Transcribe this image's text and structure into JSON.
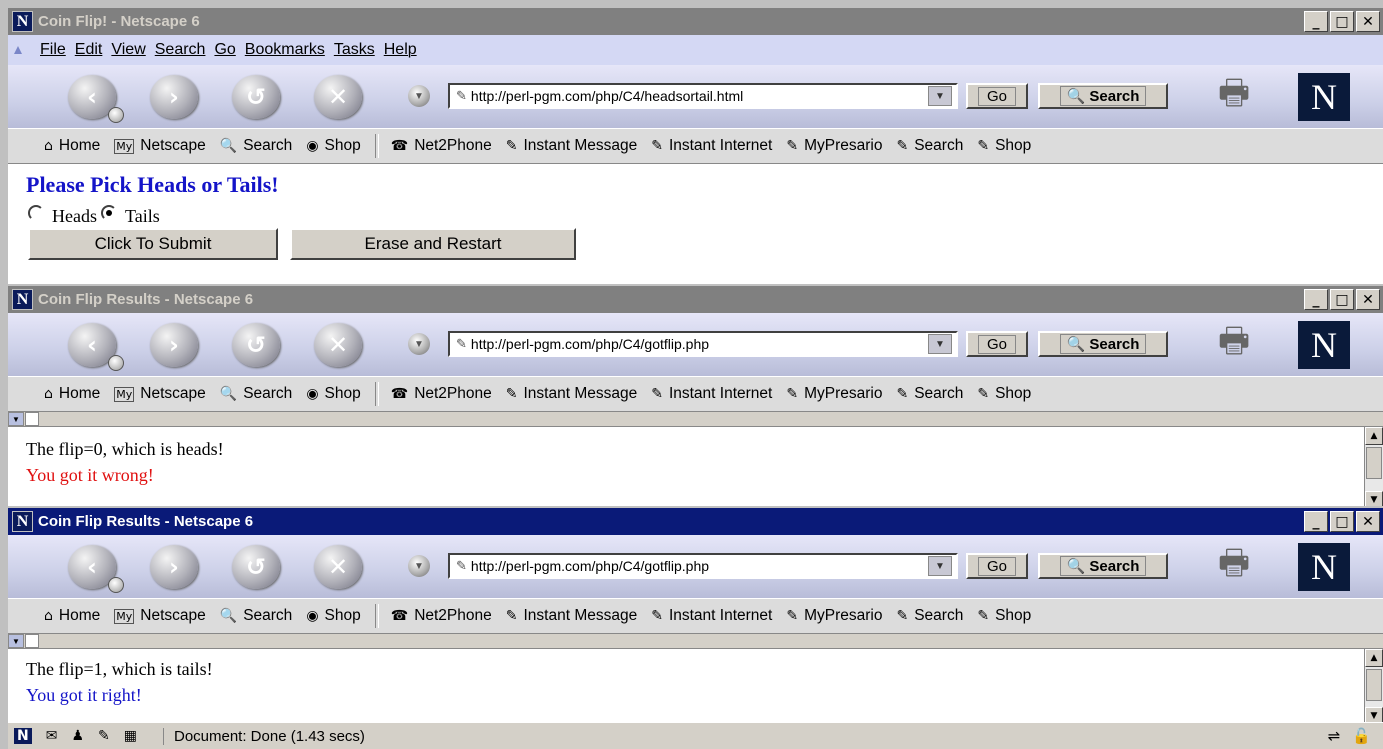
{
  "windows": [
    {
      "title": "Coin Flip! - Netscape 6",
      "url": "http://perl-pgm.com/php/C4/headsortail.html"
    },
    {
      "title": "Coin Flip Results - Netscape 6",
      "url": "http://perl-pgm.com/php/C4/gotflip.php"
    },
    {
      "title": "Coin Flip Results - Netscape 6",
      "url": "http://perl-pgm.com/php/C4/gotflip.php"
    }
  ],
  "menu": {
    "file": "File",
    "edit": "Edit",
    "view": "View",
    "search": "Search",
    "go": "Go",
    "bookmarks": "Bookmarks",
    "tasks": "Tasks",
    "help": "Help"
  },
  "toolbar": {
    "go_label": "Go",
    "search_label": "Search"
  },
  "personal_bar": {
    "home": "Home",
    "my_netscape": "Netscape",
    "my_badge": "My",
    "search": "Search",
    "shop": "Shop",
    "net2phone": "Net2Phone",
    "instant_message": "Instant Message",
    "instant_internet": "Instant Internet",
    "mypresario": "MyPresario",
    "search2": "Search",
    "shop2": "Shop"
  },
  "form_page": {
    "heading": "Please Pick Heads or Tails!",
    "options": [
      "Heads",
      "Tails"
    ],
    "selected": "Tails",
    "submit_label": "Click To Submit",
    "reset_label": "Erase and Restart"
  },
  "result_wrong": {
    "line1": "The flip=0, which is heads!",
    "line2": "You got it wrong!",
    "line2_color": "#e01010"
  },
  "result_right": {
    "line1": "The flip=1, which is tails!",
    "line2": "You got it right!",
    "line2_color": "#1414c8"
  },
  "status": {
    "text": "Document: Done (1.43 secs)"
  },
  "colors": {
    "heading": "#1414c8",
    "active_title": "#0a1a78",
    "inactive_title": "#808080"
  }
}
